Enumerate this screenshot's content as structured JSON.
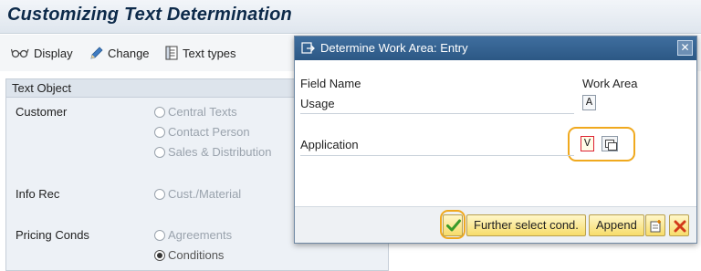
{
  "page": {
    "title": "Customizing Text Determination"
  },
  "toolbar": {
    "display_label": "Display",
    "change_label": "Change",
    "text_types_label": "Text types"
  },
  "text_object": {
    "header": "Text Object",
    "groups": [
      {
        "label": "Customer",
        "options": [
          "Central Texts",
          "Contact Person",
          "Sales & Distribution"
        ]
      },
      {
        "label": "Info Rec",
        "options": [
          "Cust./Material"
        ]
      },
      {
        "label": "Pricing Conds",
        "options": [
          "Agreements",
          "Conditions"
        ],
        "selected": "Conditions"
      }
    ]
  },
  "dialog": {
    "title": "Determine Work Area: Entry",
    "close_icon": "close-icon",
    "col_field_name": "Field Name",
    "col_work_area": "Work Area",
    "rows": [
      {
        "label": "Usage",
        "value": "A"
      },
      {
        "label": "Application",
        "value": "V"
      }
    ],
    "footer": {
      "further_label": "Further select cond.",
      "append_label": "Append"
    }
  },
  "colors": {
    "dialog_title_bg": "#2c5885",
    "button_yellow": "#f7dc6a",
    "highlight_ring": "#f0a91e",
    "check_green": "#3a9a2a",
    "cancel_red": "#d23a1a"
  }
}
